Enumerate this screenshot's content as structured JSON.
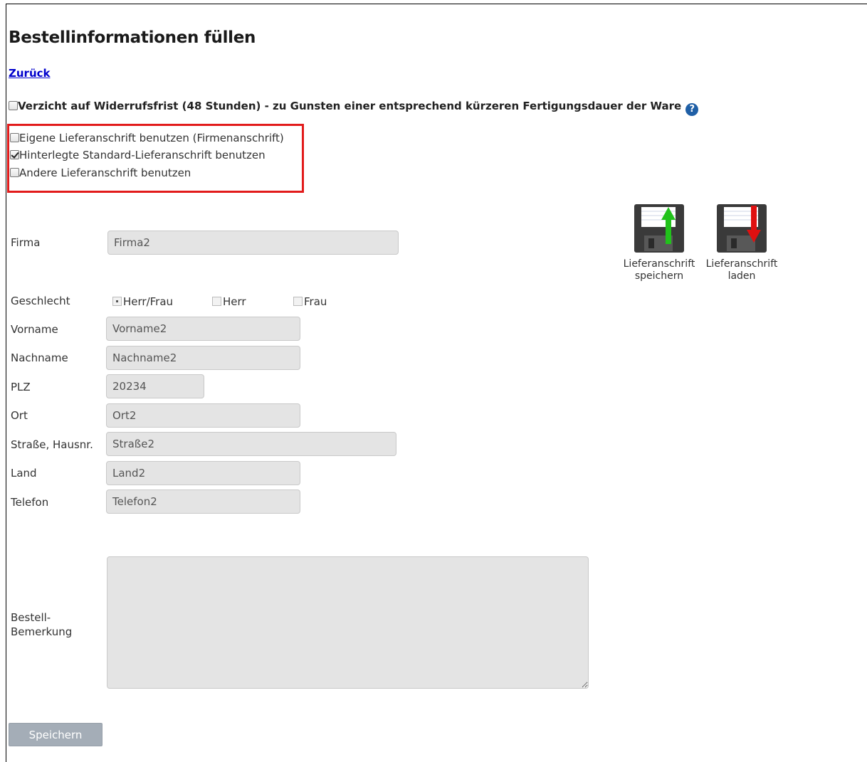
{
  "page": {
    "title": "Bestellinformationen füllen",
    "back_link": "Zurück",
    "waiver_label": "Verzicht auf Widerrufsfrist (48 Stunden) - zu Gunsten einer entsprechend kürzeren Fertigungsdauer der Ware",
    "waiver_checked": false,
    "help_icon": "?"
  },
  "address_options": [
    {
      "label": "Eigene Lieferanschrift benutzen (Firmenanschrift)",
      "checked": false
    },
    {
      "label": "Hinterlegte Standard-Lieferanschrift benutzen",
      "checked": true
    },
    {
      "label": "Andere Lieferanschrift benutzen",
      "checked": false
    }
  ],
  "actions": {
    "save_address_label": "Lieferanschrift speichern",
    "load_address_label": "Lieferanschrift laden",
    "save_address_icon": "floppy-disk-upload-icon",
    "load_address_icon": "floppy-disk-download-icon",
    "upload_arrow_color": "#21c21b",
    "download_arrow_color": "#e01010"
  },
  "form": {
    "company": {
      "label": "Firma",
      "value": "Firma2"
    },
    "gender": {
      "label": "Geschlecht",
      "options": [
        {
          "label": "Herr/Frau",
          "selected": true
        },
        {
          "label": "Herr",
          "selected": false
        },
        {
          "label": "Frau",
          "selected": false
        }
      ]
    },
    "first_name": {
      "label": "Vorname",
      "value": "Vorname2"
    },
    "last_name": {
      "label": "Nachname",
      "value": "Nachname2"
    },
    "zip": {
      "label": "PLZ",
      "value": "20234"
    },
    "city": {
      "label": "Ort",
      "value": "Ort2"
    },
    "street": {
      "label": "Straße, Hausnr.",
      "value": "Straße2"
    },
    "country": {
      "label": "Land",
      "value": "Land2"
    },
    "phone": {
      "label": "Telefon",
      "value": "Telefon2"
    },
    "remark": {
      "label_line1": "Bestell-",
      "label_line2": "Bemerkung",
      "value": ""
    }
  },
  "submit": {
    "label": "Speichern"
  },
  "colors": {
    "highlight_border": "#e21b1b",
    "link": "#0000cc",
    "input_bg": "#e4e4e4",
    "button_bg": "#a4adb7"
  }
}
